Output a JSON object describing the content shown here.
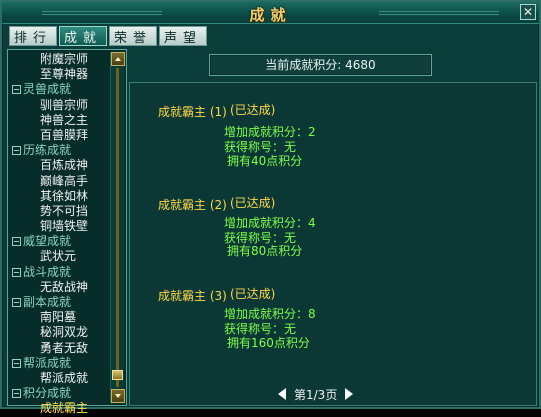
{
  "window": {
    "title": "成就",
    "close_label": "✕"
  },
  "tabs": [
    {
      "label": "排行",
      "active": false
    },
    {
      "label": "成就",
      "active": true
    },
    {
      "label": "荣誉",
      "active": false
    },
    {
      "label": "声望",
      "active": false
    }
  ],
  "tree": [
    {
      "type": "item",
      "label": "附魔宗师"
    },
    {
      "type": "item",
      "label": "至尊神器"
    },
    {
      "type": "category",
      "label": "灵兽成就"
    },
    {
      "type": "item",
      "label": "驯兽宗师"
    },
    {
      "type": "item",
      "label": "神兽之主"
    },
    {
      "type": "item",
      "label": "百兽膜拜"
    },
    {
      "type": "category",
      "label": "历练成就"
    },
    {
      "type": "item",
      "label": "百炼成神"
    },
    {
      "type": "item",
      "label": "巅峰高手"
    },
    {
      "type": "item",
      "label": "其徐如林"
    },
    {
      "type": "item",
      "label": "势不可挡"
    },
    {
      "type": "item",
      "label": "铜墙铁壁"
    },
    {
      "type": "category",
      "label": "威望成就"
    },
    {
      "type": "item",
      "label": "武状元"
    },
    {
      "type": "category",
      "label": "战斗成就"
    },
    {
      "type": "item",
      "label": "无敌战神"
    },
    {
      "type": "category",
      "label": "副本成就"
    },
    {
      "type": "item",
      "label": "南阳墓"
    },
    {
      "type": "item",
      "label": "秘洞双龙"
    },
    {
      "type": "item",
      "label": "勇者无敌"
    },
    {
      "type": "category",
      "label": "帮派成就"
    },
    {
      "type": "item",
      "label": "帮派成就"
    },
    {
      "type": "category",
      "label": "积分成就"
    },
    {
      "type": "item",
      "label": "成就霸主",
      "selected": true
    }
  ],
  "scrollbar": {
    "position_fraction": 0.97
  },
  "score": {
    "text": "当前成就积分: 4680"
  },
  "achievements": [
    {
      "name": "成就霸主 (1)",
      "status": "(已达成)",
      "points": "增加成就积分：2",
      "title": "获得称号：无",
      "owned": "拥有40点积分"
    },
    {
      "name": "成就霸主 (2)",
      "status": "(已达成)",
      "points": "增加成就积分：4",
      "title": "获得称号：无",
      "owned": "拥有80点积分"
    },
    {
      "name": "成就霸主 (3)",
      "status": "(已达成)",
      "points": "增加成就积分：8",
      "title": "获得称号：无",
      "owned": "拥有160点积分"
    }
  ],
  "pager": {
    "text": "第1/3页"
  },
  "icons": [
    "close-icon",
    "minus-box-icon",
    "scroll-up-icon",
    "scroll-down-icon",
    "prev-page-icon",
    "next-page-icon"
  ]
}
